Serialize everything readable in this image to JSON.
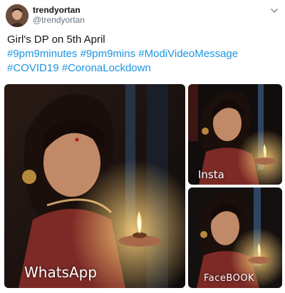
{
  "tweet": {
    "author": {
      "display_name": "trendyortan",
      "handle": "@trendyortan",
      "avatar_icon": "avatar-photo"
    },
    "menu_icon": "chevron-down-icon",
    "text_line1": "Girl's DP on 5th April",
    "hashtags_line2": [
      "#9pm9minutes",
      "#9pm9mins",
      "#ModiVideoMessage"
    ],
    "hashtags_line3": [
      "#COVID19",
      "#CoronaLockdown"
    ],
    "hashtag_color": "#1b95e0"
  },
  "media": {
    "images": [
      {
        "label": "WhatsApp"
      },
      {
        "label": "Insta"
      },
      {
        "label": "FaceBOOK"
      }
    ]
  }
}
